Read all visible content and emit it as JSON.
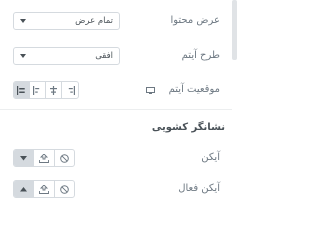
{
  "content_width": {
    "label": "عرض محتوا",
    "value": "تمام عرض"
  },
  "item_type": {
    "label": "طرح آیتم",
    "value": "افقی"
  },
  "item_position": {
    "label": "موقعیت آیتم"
  },
  "dropdown_indicator": {
    "title": "نشانگر کشویی"
  },
  "icon": {
    "label": "آیکن"
  },
  "active_icon": {
    "label": "آیکن فعال"
  },
  "colors": {
    "active_bg": "#d5dadf",
    "border": "#d5dadf",
    "text": "#6d7882"
  }
}
